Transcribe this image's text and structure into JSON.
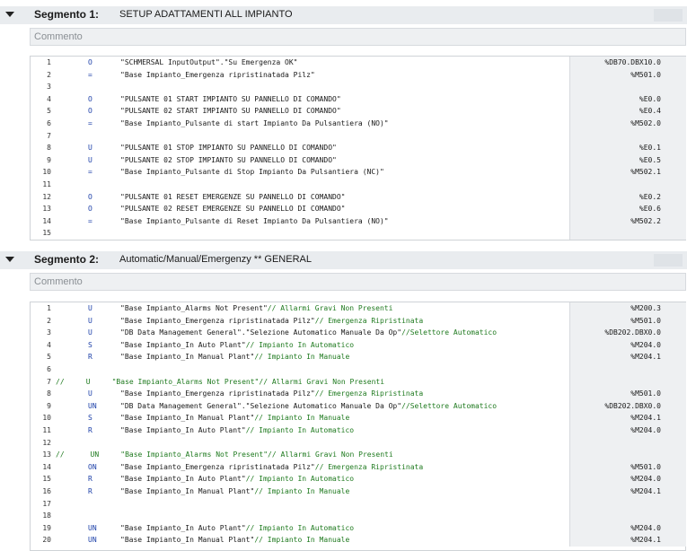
{
  "segments": [
    {
      "title": "Segmento 1:",
      "description": "SETUP ADATTAMENTI ALL IMPIANTO",
      "comment_placeholder": "Commento",
      "lines": [
        {
          "n": "1",
          "op": "O",
          "expr": "\"SCHMERSAL InputOutput\".\"Su Emergenza OK\"",
          "cm": "",
          "addr": "%DB70.DBX10.0"
        },
        {
          "n": "2",
          "op": "=",
          "expr": "\"Base Impianto_Emergenza ripristinatada Pilz\"",
          "cm": "",
          "addr": "%M501.0"
        },
        {
          "n": "3",
          "op": "",
          "expr": "",
          "cm": "",
          "addr": ""
        },
        {
          "n": "4",
          "op": "O",
          "expr": "\"PULSANTE 01 START IMPIANTO SU PANNELLO DI COMANDO\"",
          "cm": "",
          "addr": "%E0.0"
        },
        {
          "n": "5",
          "op": "O",
          "expr": "\"PULSANTE 02 START IMPIANTO SU PANNELLO DI COMANDO\"",
          "cm": "",
          "addr": "%E0.4"
        },
        {
          "n": "6",
          "op": "=",
          "expr": "\"Base Impianto_Pulsante di start Impianto Da Pulsantiera (NO)\"",
          "cm": "",
          "addr": "%M502.0"
        },
        {
          "n": "7",
          "op": "",
          "expr": "",
          "cm": "",
          "addr": ""
        },
        {
          "n": "8",
          "op": "U",
          "expr": "\"PULSANTE 01 STOP IMPIANTO SU PANNELLO DI COMANDO\"",
          "cm": "",
          "addr": "%E0.1"
        },
        {
          "n": "9",
          "op": "U",
          "expr": "\"PULSANTE 02 STOP IMPIANTO SU PANNELLO DI COMANDO\"",
          "cm": "",
          "addr": "%E0.5"
        },
        {
          "n": "10",
          "op": "=",
          "expr": "\"Base Impianto_Pulsante di Stop Impianto Da Pulsantiera (NC)\"",
          "cm": "",
          "addr": "%M502.1"
        },
        {
          "n": "11",
          "op": "",
          "expr": "",
          "cm": "",
          "addr": ""
        },
        {
          "n": "12",
          "op": "O",
          "expr": "\"PULSANTE 01 RESET EMERGENZE SU PANNELLO DI COMANDO\"",
          "cm": "",
          "addr": "%E0.2"
        },
        {
          "n": "13",
          "op": "O",
          "expr": "\"PULSANTE 02 RESET EMERGENZE SU PANNELLO DI COMANDO\"",
          "cm": "",
          "addr": "%E0.6"
        },
        {
          "n": "14",
          "op": "=",
          "expr": "\"Base Impianto_Pulsante di Reset Impianto Da Pulsantiera (NO)\"",
          "cm": "",
          "addr": "%M502.2"
        },
        {
          "n": "15",
          "op": "",
          "expr": "",
          "cm": "",
          "addr": ""
        }
      ]
    },
    {
      "title": "Segmento 2:",
      "description": "Automatic/Manual/Emergenzy ** GENERAL",
      "comment_placeholder": "Commento",
      "lines": [
        {
          "n": "1",
          "op": "U",
          "expr": "\"Base Impianto_Alarms Not Present\"",
          "cm": "// Allarmi Gravi Non Presenti",
          "addr": "%M200.3"
        },
        {
          "n": "2",
          "op": "U",
          "expr": "\"Base Impianto_Emergenza ripristinatada Pilz\"",
          "cm": "// Emergenza Ripristinata",
          "addr": "%M501.0"
        },
        {
          "n": "3",
          "op": "U",
          "expr": "\"DB Data Management General\".\"Selezione Automatico Manuale Da Op\"",
          "cm": "//Selettore Automatico",
          "addr": "%DB202.DBX0.0"
        },
        {
          "n": "4",
          "op": "S",
          "expr": "\"Base Impianto_In Auto Plant\"",
          "cm": "// Impianto In Automatico",
          "addr": "%M204.0"
        },
        {
          "n": "5",
          "op": "R",
          "expr": "\"Base Impianto_In Manual Plant\"",
          "cm": "// Impianto In Manuale",
          "addr": "%M204.1"
        },
        {
          "n": "6",
          "op": "",
          "expr": "",
          "cm": "",
          "addr": ""
        },
        {
          "n": "7",
          "op": "",
          "expr": "",
          "cm": "",
          "addr": "",
          "commented": "//     U     \"Base Impianto_Alarms Not Present\"// Allarmi Gravi Non Presenti"
        },
        {
          "n": "8",
          "op": "U",
          "expr": "\"Base Impianto_Emergenza ripristinatada Pilz\"",
          "cm": "// Emergenza Ripristinata",
          "addr": "%M501.0"
        },
        {
          "n": "9",
          "op": "UN",
          "expr": "\"DB Data Management General\".\"Selezione Automatico Manuale Da Op\"",
          "cm": "//Selettore Automatico",
          "addr": "%DB202.DBX0.0"
        },
        {
          "n": "10",
          "op": "S",
          "expr": "\"Base Impianto_In Manual Plant\"",
          "cm": "// Impianto In Manuale",
          "addr": "%M204.1"
        },
        {
          "n": "11",
          "op": "R",
          "expr": "\"Base Impianto_In Auto Plant\"",
          "cm": "// Impianto In Automatico",
          "addr": "%M204.0"
        },
        {
          "n": "12",
          "op": "",
          "expr": "",
          "cm": "",
          "addr": ""
        },
        {
          "n": "13",
          "op": "",
          "expr": "",
          "cm": "",
          "addr": "",
          "commented": "//      UN     \"Base Impianto_Alarms Not Present\"// Allarmi Gravi Non Presenti"
        },
        {
          "n": "14",
          "op": "ON",
          "expr": "\"Base Impianto_Emergenza ripristinatada Pilz\"",
          "cm": "// Emergenza Ripristinata",
          "addr": "%M501.0"
        },
        {
          "n": "15",
          "op": "R",
          "expr": "\"Base Impianto_In Auto Plant\"",
          "cm": "// Impianto In Automatico",
          "addr": "%M204.0"
        },
        {
          "n": "16",
          "op": "R",
          "expr": "\"Base Impianto_In Manual Plant\"",
          "cm": "// Impianto In Manuale",
          "addr": "%M204.1"
        },
        {
          "n": "17",
          "op": "",
          "expr": "",
          "cm": "",
          "addr": ""
        },
        {
          "n": "18",
          "op": "",
          "expr": "",
          "cm": "",
          "addr": ""
        },
        {
          "n": "19",
          "op": "UN",
          "expr": "\"Base Impianto_In Auto Plant\"",
          "cm": "// Impianto In Automatico",
          "addr": "%M204.0"
        },
        {
          "n": "20",
          "op": "UN",
          "expr": "\"Base Impianto_In Manual Plant\"",
          "cm": "// Impianto In Manuale",
          "addr": "%M204.1"
        }
      ]
    }
  ]
}
